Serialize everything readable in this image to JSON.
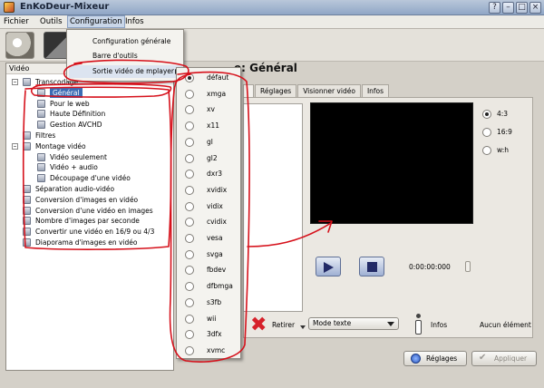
{
  "window": {
    "title": "EnKoDeur-Mixeur",
    "buttons": [
      "?",
      "–",
      "□",
      "×"
    ]
  },
  "menubar": [
    "Fichier",
    "Outils",
    "Configuration",
    "Infos"
  ],
  "config_menu": {
    "items": [
      "Configuration générale",
      "Barre d'outils",
      "Sortie vidéo de mplayer"
    ],
    "open_submenu": "Sortie vidéo de mplayer"
  },
  "mplayer_submenu": {
    "selected": "défaut",
    "options": [
      "défaut",
      "xmga",
      "xv",
      "x11",
      "gl",
      "gl2",
      "dxr3",
      "xvidix",
      "vidix",
      "cvidix",
      "vesa",
      "svga",
      "fbdev",
      "dfbmga",
      "s3fb",
      "wii",
      "3dfx",
      "xvmc"
    ]
  },
  "left_panel": {
    "header": "Vidéo",
    "tree": [
      {
        "label": "Transcodage",
        "level": 0,
        "expanded": true
      },
      {
        "label": "Général",
        "level": 1,
        "selected": true
      },
      {
        "label": "Pour le web",
        "level": 1
      },
      {
        "label": "Haute Définition",
        "level": 1
      },
      {
        "label": "Gestion AVCHD",
        "level": 1
      },
      {
        "label": "Filtres",
        "level": 0
      },
      {
        "label": "Montage vidéo",
        "level": 0,
        "expanded": true
      },
      {
        "label": "Vidéo seulement",
        "level": 1
      },
      {
        "label": "Vidéo + audio",
        "level": 1
      },
      {
        "label": "Découpage d'une vidéo",
        "level": 1
      },
      {
        "label": "Séparation audio-vidéo",
        "level": 0
      },
      {
        "label": "Conversion d'images en vidéo",
        "level": 0
      },
      {
        "label": "Conversion d'une vidéo en images",
        "level": 0
      },
      {
        "label": "Nombre d'images par seconde",
        "level": 0
      },
      {
        "label": "Convertir une vidéo en 16/9 ou 4/3",
        "level": 0
      },
      {
        "label": "Diaporama d'images en vidéo",
        "level": 0
      }
    ]
  },
  "main": {
    "heading": "e: Général",
    "tabs": [
      "Réglages",
      "Visionner vidéo",
      "Infos"
    ],
    "ratios": [
      {
        "label": "4:3",
        "selected": true
      },
      {
        "label": "16:9"
      },
      {
        "label": "w:h"
      }
    ],
    "timecode": "0:00:00:000",
    "retirer": "Retirer",
    "mode_select": "Mode texte",
    "infos": "Infos",
    "status": "Aucun élément"
  },
  "footer": {
    "reglages": "Réglages",
    "appliquer": "Appliquer"
  },
  "colors": {
    "selection": "#3c6cb4",
    "annotation": "#d6111b"
  }
}
